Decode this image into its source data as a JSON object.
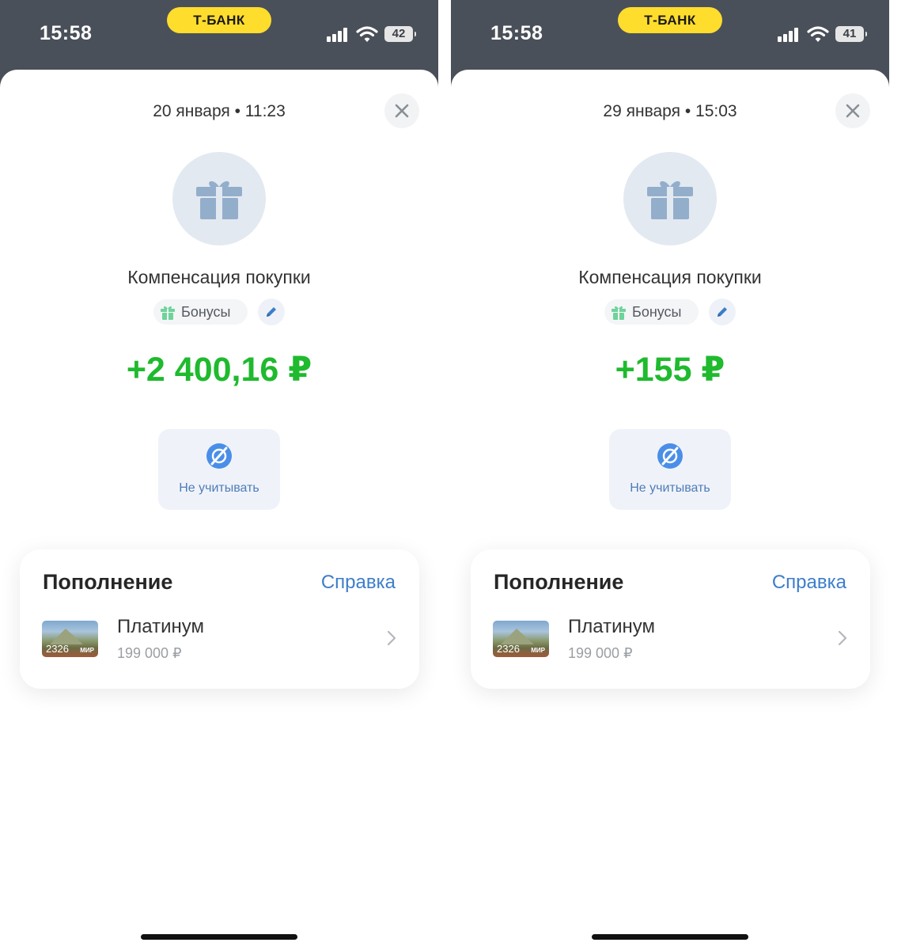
{
  "screens": [
    {
      "status": {
        "time": "15:58",
        "brand": "Т-БАНК",
        "battery": "42"
      },
      "date": "20 января • 11:23",
      "title": "Компенсация покупки",
      "category": "Бонусы",
      "amount": "+2 400,16 ₽",
      "ignore_label": "Не учитывать",
      "section": {
        "title": "Пополнение",
        "help": "Справка",
        "account": {
          "card_number": "2326",
          "card_brand": "МИР",
          "name": "Платинум",
          "balance": "199 000 ₽"
        }
      }
    },
    {
      "status": {
        "time": "15:58",
        "brand": "Т-БАНК",
        "battery": "41"
      },
      "date": "29 января • 15:03",
      "title": "Компенсация покупки",
      "category": "Бонусы",
      "amount": "+155 ₽",
      "ignore_label": "Не учитывать",
      "section": {
        "title": "Пополнение",
        "help": "Справка",
        "account": {
          "card_number": "2326",
          "card_brand": "МИР",
          "name": "Платинум",
          "balance": "199 000 ₽"
        }
      }
    }
  ],
  "colors": {
    "status_bar": "#4a5059",
    "brand_badge": "#ffdd2d",
    "amount_positive": "#1fba2e",
    "link": "#3d7ec9",
    "icon_circle": "#e3e9f1"
  },
  "icons": [
    "signal-icon",
    "wifi-icon",
    "battery-icon",
    "close-icon",
    "gift-icon",
    "edit-icon",
    "eye-off-icon",
    "chevron-right-icon"
  ]
}
